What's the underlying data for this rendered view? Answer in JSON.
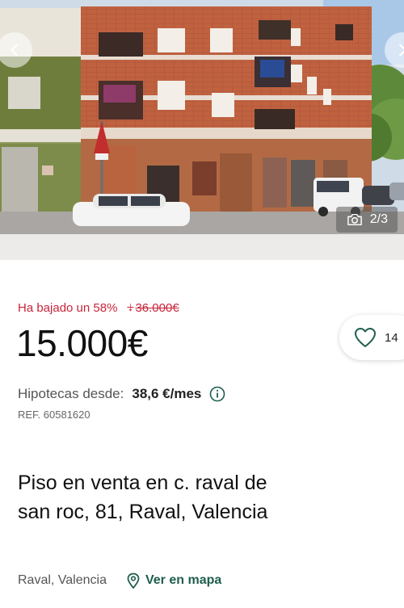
{
  "gallery": {
    "counter": "2/3",
    "icons": {
      "prev": "chevron-left-icon",
      "next": "chevron-right-icon",
      "camera": "camera-icon"
    }
  },
  "price": {
    "drop_label": "Ha bajado un 58%",
    "old_price": "36.000€",
    "current": "15.000€",
    "drop_color": "#c8243a"
  },
  "favorite": {
    "count": "14",
    "icon": "heart-icon"
  },
  "mortgage": {
    "label": "Hipotecas desde:",
    "amount": "38,6 €/mes",
    "icon": "info-icon"
  },
  "reference": "REF. 60581620",
  "listing": {
    "title": "Piso en venta en c. raval de san roc, 81, Raval, Valencia",
    "location": "Raval, Valencia",
    "map_link": "Ver en mapa",
    "map_icon": "map-pin-icon",
    "accent_color": "#1f5e4e"
  }
}
